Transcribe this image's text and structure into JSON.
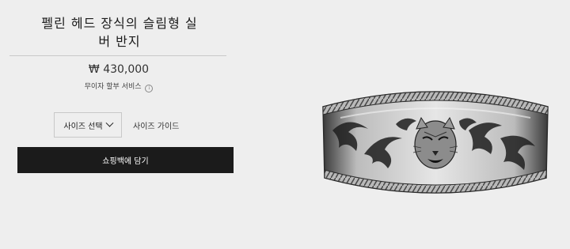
{
  "product": {
    "title_line1": "펠린 헤드 장식의 슬림형 실",
    "title_line2": "버 반지",
    "price": "₩ 430,000",
    "installment_text": "무이자 할부 서비스"
  },
  "controls": {
    "size_select_label": "사이즈 선택",
    "size_guide_label": "사이즈 가이드",
    "add_to_cart_label": "쇼핑백에 담기"
  },
  "colors": {
    "background": "#eeeeee",
    "button": "#1b1b1b",
    "button_text": "#ffffff"
  },
  "image": {
    "icon": "silver-ring-feline-head"
  }
}
